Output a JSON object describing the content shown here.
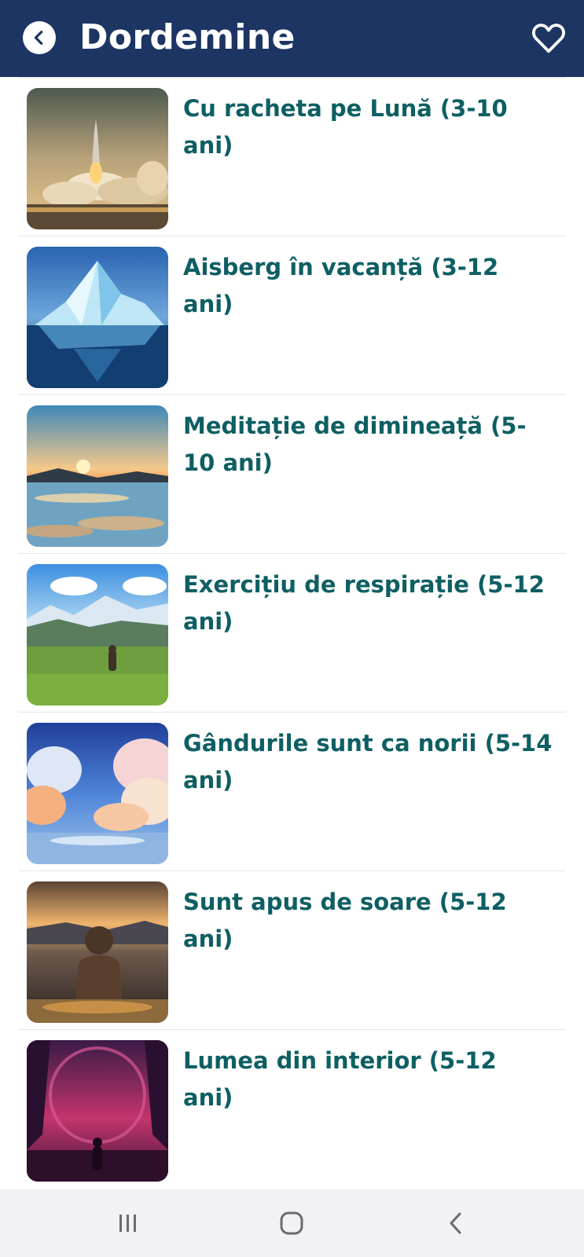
{
  "header": {
    "title": "Dordemine",
    "back_icon": "chevron-left-circle-icon",
    "favorite_icon": "heart-outline-icon",
    "background_color": "#1c3563"
  },
  "items": [
    {
      "title": "Cu racheta pe Lună (3-10 ani)",
      "image": "rocket-launch-image"
    },
    {
      "title": "Aisberg în vacanță (3-12 ani)",
      "image": "iceberg-image"
    },
    {
      "title": "Meditație de dimineață (5-10 ani)",
      "image": "sunrise-lake-image"
    },
    {
      "title": "Exercițiu de respirație (5-12 ani)",
      "image": "mountain-meadow-image"
    },
    {
      "title": "Gândurile sunt ca norii (5-14 ani)",
      "image": "clouds-image"
    },
    {
      "title": "Sunt apus de soare (5-12 ani)",
      "image": "child-sunset-image"
    },
    {
      "title": "Lumea din interior (5-12 ani)",
      "image": "fantasy-world-image"
    }
  ],
  "colors": {
    "title_text": "#0e5f63",
    "divider": "#e6e6e6"
  },
  "system_nav": {
    "recents_icon": "recents-icon",
    "home_icon": "home-icon",
    "back_icon": "back-icon"
  }
}
